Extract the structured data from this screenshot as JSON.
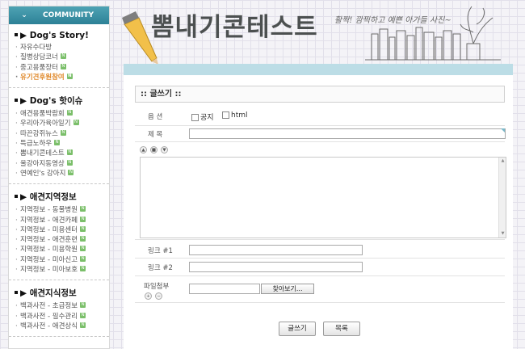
{
  "sidebar": {
    "header": "COMMUNITY",
    "sections": [
      {
        "title": "Dog's Story!",
        "items": [
          {
            "label": "자유수다방",
            "new": false,
            "active": false
          },
          {
            "label": "질병상담코너",
            "new": true,
            "active": false
          },
          {
            "label": "중고용품장터",
            "new": true,
            "active": false
          },
          {
            "label": "유기견후원참여",
            "new": true,
            "active": true
          }
        ]
      },
      {
        "title": "Dog's 핫이슈",
        "items": [
          {
            "label": "애견용품박람회",
            "new": true,
            "active": false
          },
          {
            "label": "우리아가육아일기",
            "new": true,
            "active": false
          },
          {
            "label": "따끈강쥐뉴스",
            "new": true,
            "active": false
          },
          {
            "label": "특급노하우",
            "new": true,
            "active": false
          },
          {
            "label": "뽐내기콘테스트",
            "new": true,
            "active": false
          },
          {
            "label": "울강아지동영상",
            "new": true,
            "active": false
          },
          {
            "label": "연예인's 강아지",
            "new": true,
            "active": false
          }
        ]
      },
      {
        "title": "애견지역정보",
        "items": [
          {
            "label": "지역정보 - 동물병원",
            "new": true,
            "active": false
          },
          {
            "label": "지역정보 - 애견카페",
            "new": true,
            "active": false
          },
          {
            "label": "지역정보 - 미용센터",
            "new": true,
            "active": false
          },
          {
            "label": "지역정보 - 애견훈련",
            "new": true,
            "active": false
          },
          {
            "label": "지역정보 - 미용학원",
            "new": true,
            "active": false
          },
          {
            "label": "지역정보 - 미아신고",
            "new": true,
            "active": false
          },
          {
            "label": "지역정보 - 미아보호",
            "new": true,
            "active": false
          }
        ]
      },
      {
        "title": "애견지식정보",
        "items": [
          {
            "label": "백과사전 - 초급정보",
            "new": true,
            "active": false
          },
          {
            "label": "백과사전 - 필수관리",
            "new": true,
            "active": false
          },
          {
            "label": "백과사전 - 애견상식",
            "new": true,
            "active": false
          }
        ]
      }
    ],
    "badge_text": "N"
  },
  "banner": {
    "title": "뽐내기콘테스트",
    "subtitle": "활짝! 깜찍하고 예쁜 아가들 사진~"
  },
  "form": {
    "heading": ":: 글쓰기 ::",
    "options_label": "옵 션",
    "opt_notice": "공지",
    "opt_html": "html",
    "subject_label": "제 목",
    "subject_value": "",
    "link1_label": "링크 #1",
    "link1_value": "",
    "link2_label": "링크 #2",
    "link2_value": "",
    "file_label": "파일첨부",
    "browse_label": "찾아보기...",
    "submit_label": "글쓰기",
    "list_label": "목록",
    "plus": "+",
    "minus": "−"
  },
  "colors": {
    "accent": "#2d8196",
    "active_item": "#e08a2c",
    "new_badge": "#7bbf6a",
    "banner_bar": "#bcdde6"
  }
}
